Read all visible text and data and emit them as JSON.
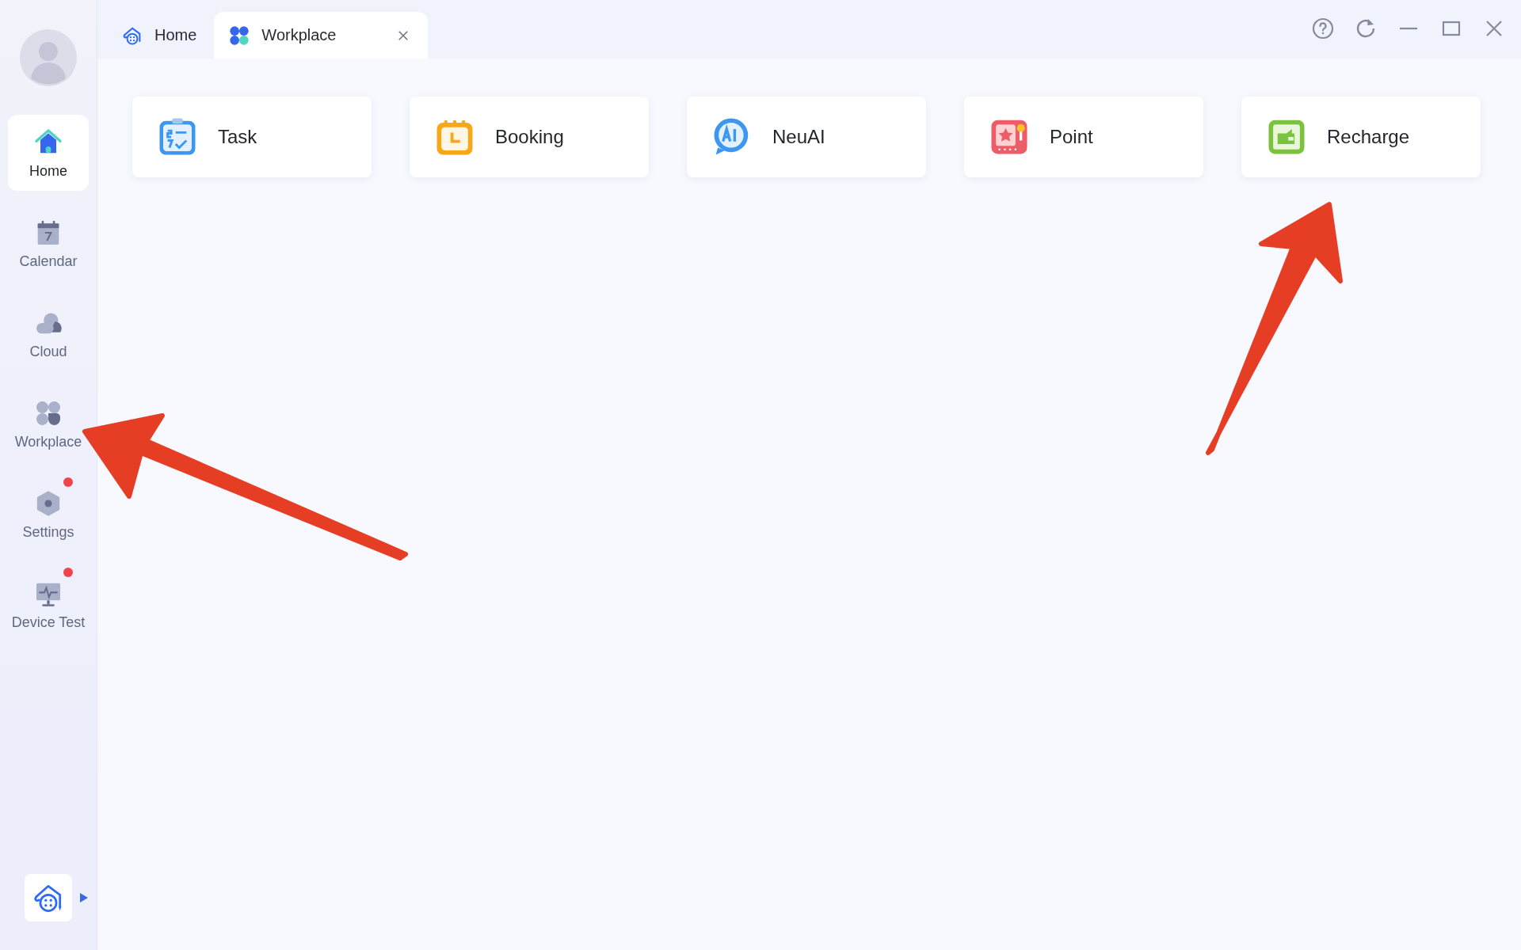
{
  "sidebar": {
    "items": [
      {
        "label": "Home",
        "kind": "home",
        "selected": true,
        "badge": false
      },
      {
        "label": "Calendar",
        "kind": "calendar",
        "selected": false,
        "badge": false
      },
      {
        "label": "Cloud",
        "kind": "cloud",
        "selected": false,
        "badge": false
      },
      {
        "label": "Workplace",
        "kind": "workplace",
        "selected": false,
        "badge": false
      },
      {
        "label": "Settings",
        "kind": "settings",
        "selected": false,
        "badge": true
      },
      {
        "label": "Device Test",
        "kind": "device",
        "selected": false,
        "badge": true
      }
    ]
  },
  "tabs": [
    {
      "label": "Home",
      "kind": "home",
      "selected": false,
      "closable": false
    },
    {
      "label": "Workplace",
      "kind": "workplace",
      "selected": true,
      "closable": true
    }
  ],
  "apps": [
    {
      "label": "Task",
      "kind": "task"
    },
    {
      "label": "Booking",
      "kind": "booking"
    },
    {
      "label": "NeuAI",
      "kind": "ai"
    },
    {
      "label": "Point",
      "kind": "point"
    },
    {
      "label": "Recharge",
      "kind": "recharge"
    }
  ]
}
